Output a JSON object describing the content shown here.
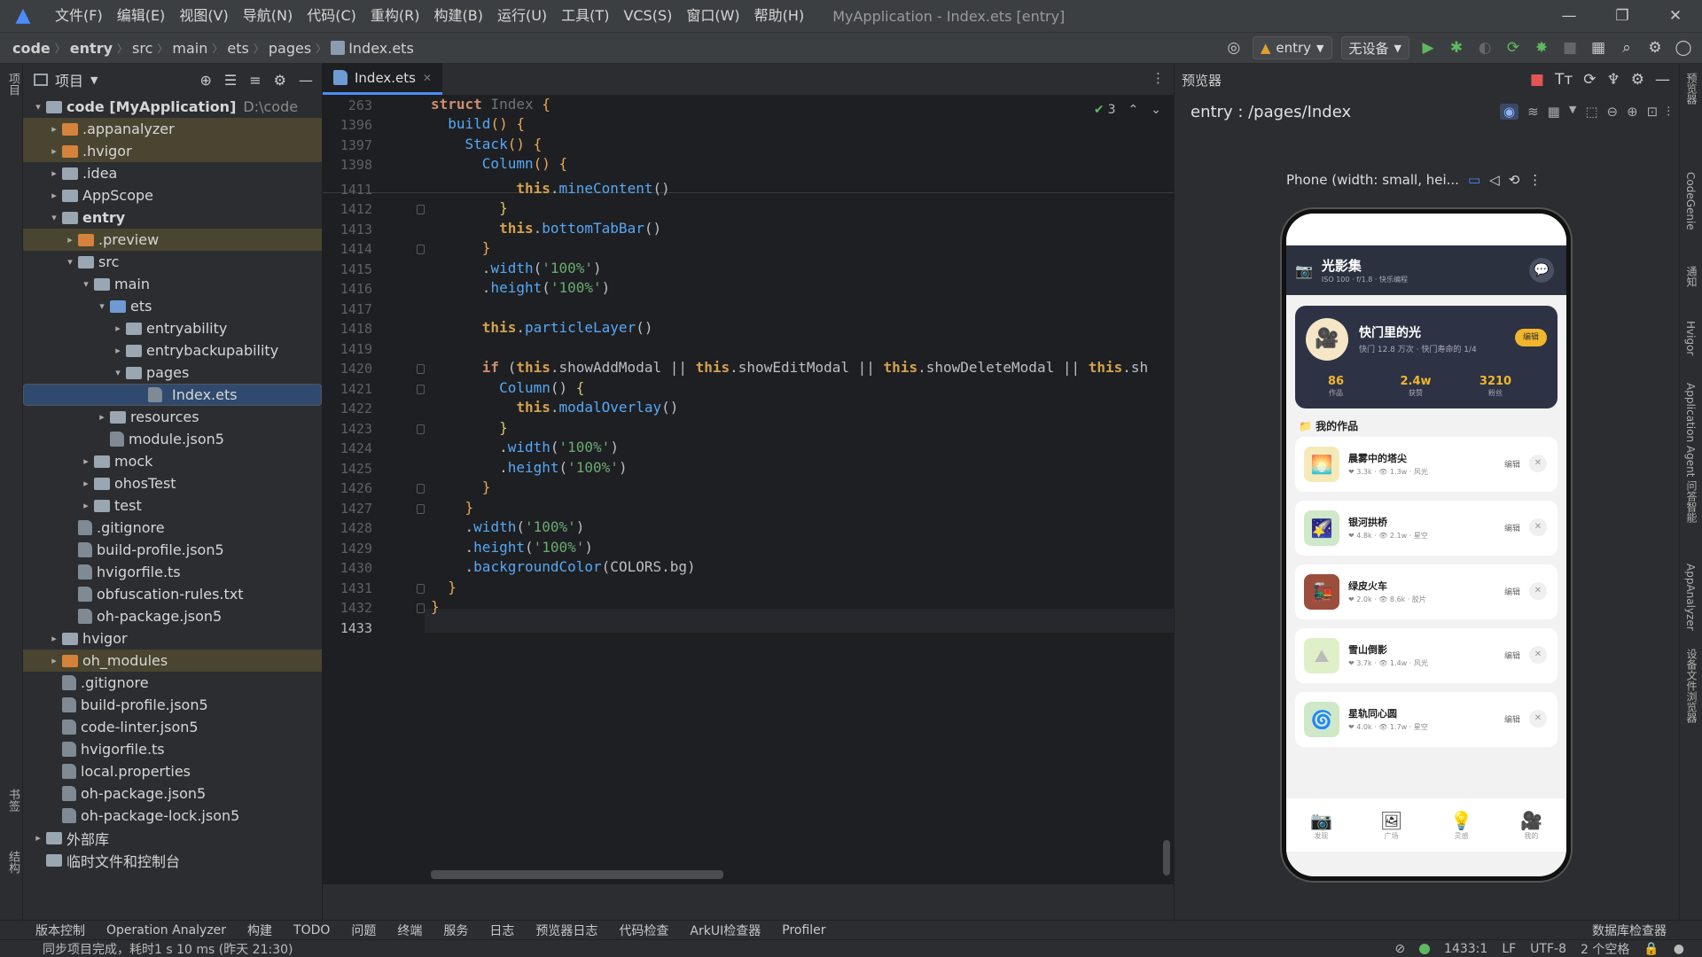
{
  "titlebar": {
    "menus": [
      "文件(F)",
      "编辑(E)",
      "视图(V)",
      "导航(N)",
      "代码(C)",
      "重构(R)",
      "构建(B)",
      "运行(U)",
      "工具(T)",
      "VCS(S)",
      "窗口(W)",
      "帮助(H)"
    ],
    "title": "MyApplication - Index.ets [entry]"
  },
  "navbar": {
    "breadcrumbs": [
      "code",
      "entry",
      "src",
      "main",
      "ets",
      "pages",
      "Index.ets"
    ],
    "module_select": "entry",
    "device_select": "无设备"
  },
  "leftstrip": {
    "project_label": "项目",
    "bookmarks_label": "书签",
    "structure_label": "结构"
  },
  "project": {
    "header": "项目",
    "tree": [
      {
        "label": "code [MyApplication]",
        "extra": "D:\\code",
        "depth": 0,
        "arrow": "▾",
        "type": "g",
        "bold": true
      },
      {
        "label": ".appanalyzer",
        "depth": 1,
        "arrow": "▸",
        "type": "o",
        "hl": true
      },
      {
        "label": ".hvigor",
        "depth": 1,
        "arrow": "▸",
        "type": "o",
        "hl": true
      },
      {
        "label": ".idea",
        "depth": 1,
        "arrow": "▸",
        "type": "g"
      },
      {
        "label": "AppScope",
        "depth": 1,
        "arrow": "▸",
        "type": "g"
      },
      {
        "label": "entry",
        "depth": 1,
        "arrow": "▾",
        "type": "g",
        "bold": true
      },
      {
        "label": ".preview",
        "depth": 2,
        "arrow": "▸",
        "type": "o",
        "hl": true
      },
      {
        "label": "src",
        "depth": 2,
        "arrow": "▾",
        "type": "g"
      },
      {
        "label": "main",
        "depth": 3,
        "arrow": "▾",
        "type": "g"
      },
      {
        "label": "ets",
        "depth": 4,
        "arrow": "▾",
        "type": "b"
      },
      {
        "label": "entryability",
        "depth": 5,
        "arrow": "▸",
        "type": "g"
      },
      {
        "label": "entrybackupability",
        "depth": 5,
        "arrow": "▸",
        "type": "g"
      },
      {
        "label": "pages",
        "depth": 5,
        "arrow": "▾",
        "type": "g"
      },
      {
        "label": "Index.ets",
        "depth": 6,
        "arrow": "",
        "type": "file",
        "sel": true
      },
      {
        "label": "resources",
        "depth": 4,
        "arrow": "▸",
        "type": "g"
      },
      {
        "label": "module.json5",
        "depth": 4,
        "arrow": "",
        "type": "file"
      },
      {
        "label": "mock",
        "depth": 3,
        "arrow": "▸",
        "type": "g"
      },
      {
        "label": "ohosTest",
        "depth": 3,
        "arrow": "▸",
        "type": "g"
      },
      {
        "label": "test",
        "depth": 3,
        "arrow": "▸",
        "type": "g"
      },
      {
        "label": ".gitignore",
        "depth": 2,
        "arrow": "",
        "type": "file"
      },
      {
        "label": "build-profile.json5",
        "depth": 2,
        "arrow": "",
        "type": "file"
      },
      {
        "label": "hvigorfile.ts",
        "depth": 2,
        "arrow": "",
        "type": "file"
      },
      {
        "label": "obfuscation-rules.txt",
        "depth": 2,
        "arrow": "",
        "type": "file"
      },
      {
        "label": "oh-package.json5",
        "depth": 2,
        "arrow": "",
        "type": "file"
      },
      {
        "label": "hvigor",
        "depth": 1,
        "arrow": "▸",
        "type": "g"
      },
      {
        "label": "oh_modules",
        "depth": 1,
        "arrow": "▸",
        "type": "o",
        "hl": true
      },
      {
        "label": ".gitignore",
        "depth": 1,
        "arrow": "",
        "type": "file"
      },
      {
        "label": "build-profile.json5",
        "depth": 1,
        "arrow": "",
        "type": "file"
      },
      {
        "label": "code-linter.json5",
        "depth": 1,
        "arrow": "",
        "type": "file"
      },
      {
        "label": "hvigorfile.ts",
        "depth": 1,
        "arrow": "",
        "type": "file"
      },
      {
        "label": "local.properties",
        "depth": 1,
        "arrow": "",
        "type": "file"
      },
      {
        "label": "oh-package.json5",
        "depth": 1,
        "arrow": "",
        "type": "file"
      },
      {
        "label": "oh-package-lock.json5",
        "depth": 1,
        "arrow": "",
        "type": "file"
      },
      {
        "label": "外部库",
        "depth": 0,
        "arrow": "▸",
        "type": "g"
      },
      {
        "label": "临时文件和控制台",
        "depth": 0,
        "arrow": "",
        "type": "g"
      }
    ]
  },
  "editor": {
    "tab_label": "Index.ets",
    "inspection_count": "3",
    "lines": [
      {
        "n": "263",
        "html": "<span class=\"kw\">struct</span> <span class=\"tp\">Index</span> <span class=\"pu\">{</span>"
      },
      {
        "n": "1396",
        "html": "  <span class=\"fn\">build</span><span class=\"pu\">()</span> <span class=\"pu\">{</span>"
      },
      {
        "n": "1397",
        "html": "    <span class=\"fn\">Stack</span><span class=\"pu\">()</span> <span class=\"pu\">{</span>"
      },
      {
        "n": "1398",
        "html": "      <span class=\"fn\">Column</span><span class=\"pu\">()</span> <span class=\"pu\">{</span>"
      },
      {
        "n": "1411",
        "html": "          <span class=\"th\">this</span>.<span class=\"fn\">mineContent</span>()"
      },
      {
        "n": "1412",
        "html": "        <span class=\"bb\">}</span>"
      },
      {
        "n": "1413",
        "html": "        <span class=\"th\">this</span>.<span class=\"fn\">bottomTabBar</span>()"
      },
      {
        "n": "1414",
        "html": "      <span class=\"pu\">}</span>"
      },
      {
        "n": "1415",
        "html": "      .<span class=\"fn\">width</span>(<span class=\"st\">'100%'</span>)"
      },
      {
        "n": "1416",
        "html": "      .<span class=\"fn\">height</span>(<span class=\"st\">'100%'</span>)"
      },
      {
        "n": "1417",
        "html": ""
      },
      {
        "n": "1418",
        "html": "      <span class=\"th\">this</span>.<span class=\"fn\">particleLayer</span>()"
      },
      {
        "n": "1419",
        "html": ""
      },
      {
        "n": "1420",
        "html": "      <span class=\"kw\">if</span> (<span class=\"th\">this</span>.showAddModal || <span class=\"th\">this</span>.showEditModal || <span class=\"th\">this</span>.showDeleteModal || <span class=\"th\">this</span>.sh"
      },
      {
        "n": "1421",
        "html": "        <span class=\"fn\">Column</span>() <span class=\"bb\">{</span>"
      },
      {
        "n": "1422",
        "html": "          <span class=\"th\">this</span>.<span class=\"fn\">modalOverlay</span>()"
      },
      {
        "n": "1423",
        "html": "        <span class=\"bb\">}</span>"
      },
      {
        "n": "1424",
        "html": "        .<span class=\"fn\">width</span>(<span class=\"st\">'100%'</span>)"
      },
      {
        "n": "1425",
        "html": "        .<span class=\"fn\">height</span>(<span class=\"st\">'100%'</span>)"
      },
      {
        "n": "1426",
        "html": "      <span class=\"pu\">}</span>"
      },
      {
        "n": "1427",
        "html": "    <span class=\"pu\">}</span>"
      },
      {
        "n": "1428",
        "html": "    .<span class=\"fn\">width</span>(<span class=\"st\">'100%'</span>)"
      },
      {
        "n": "1429",
        "html": "    .<span class=\"fn\">height</span>(<span class=\"st\">'100%'</span>)"
      },
      {
        "n": "1430",
        "html": "    .<span class=\"fn\">backgroundColor</span>(COLORS.bg)"
      },
      {
        "n": "1431",
        "html": "  <span class=\"pu\">}</span>"
      },
      {
        "n": "1432",
        "html": "<span class=\"pu\">}</span>"
      },
      {
        "n": "1433",
        "html": ""
      }
    ]
  },
  "preview": {
    "header": "预览器",
    "route": "entry : /pages/Index",
    "device_label": "Phone (width: small, hei...",
    "app": {
      "title": "光影集",
      "subtitle": "ISO 100 · f/1.8 · 快乐编程",
      "profile_name": "快门里的光",
      "profile_sub": "快门 12.8 万次 · 快门寿命的 1/4",
      "edit_label": "编辑",
      "stats": [
        {
          "value": "86",
          "label": "作品"
        },
        {
          "value": "2.4w",
          "label": "获赞"
        },
        {
          "value": "3210",
          "label": "粉丝"
        }
      ],
      "section_title": "我的作品",
      "works": [
        {
          "title": "晨雾中的塔尖",
          "meta": "❤ 3.3k · 👁 1.3w · 风光",
          "thumb": "🌅",
          "bg": "#f5e9b8"
        },
        {
          "title": "银河拱桥",
          "meta": "❤ 4.8k · 👁 2.1w · 星空",
          "thumb": "🌠",
          "bg": "#cfe8c8"
        },
        {
          "title": "绿皮火车",
          "meta": "❤ 2.0k · 👁 8.6k · 胶片",
          "thumb": "🚂",
          "bg": "#9c4e3c"
        },
        {
          "title": "雪山倒影",
          "meta": "❤ 3.7k · 👁 1.4w · 风光",
          "thumb": "⛰",
          "bg": "#dff0c8"
        },
        {
          "title": "星轨同心圆",
          "meta": "❤ 4.0k · 👁 1.7w · 星空",
          "thumb": "🌀",
          "bg": "#cfe8c8"
        }
      ],
      "work_edit_label": "编辑",
      "tabs": [
        {
          "icon": "📷",
          "label": "发现"
        },
        {
          "icon": "🖼",
          "label": "广场"
        },
        {
          "icon": "💡",
          "label": "灵感"
        },
        {
          "icon": "🎥",
          "label": "我的"
        }
      ]
    }
  },
  "rightstrip": [
    "预览器",
    "CodeGenie",
    "通知",
    "Hvigor",
    "Application Agent",
    "问答智能",
    "AppAnalyzer",
    "设备文件浏览器"
  ],
  "toolwindows": [
    "版本控制",
    "Operation Analyzer",
    "构建",
    "TODO",
    "问题",
    "终端",
    "服务",
    "日志",
    "预览器日志",
    "代码检查",
    "ArkUI检查器",
    "Profiler"
  ],
  "toolwindow_right": "数据库检查器",
  "status": {
    "message": "同步项目完成，耗时1 s 10 ms (昨天 21:30)",
    "position": "1433:1",
    "line_sep": "LF",
    "encoding": "UTF-8",
    "indent": "2 个空格"
  }
}
